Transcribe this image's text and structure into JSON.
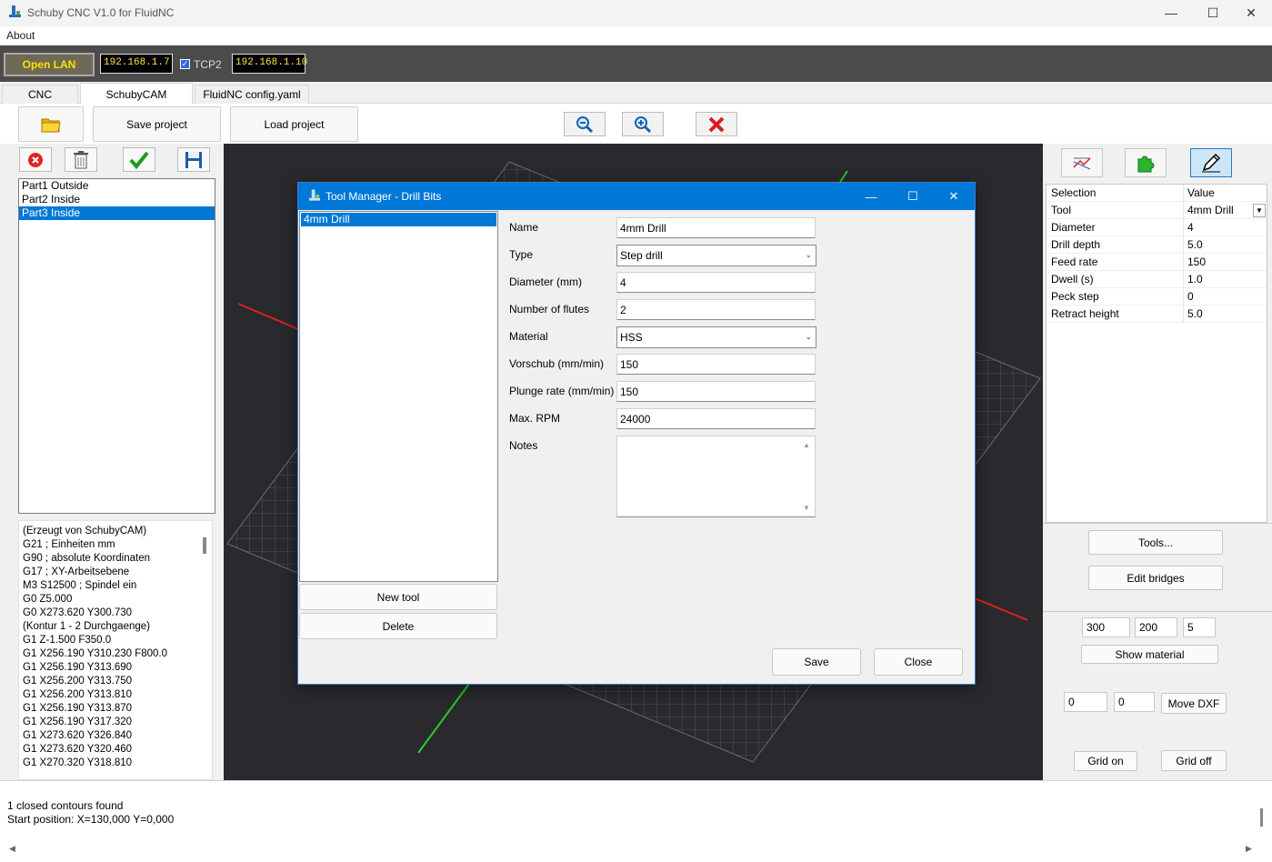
{
  "window": {
    "title": "Schuby CNC  V1.0 for FluidNC",
    "menu": [
      "About"
    ]
  },
  "network": {
    "open_lan_label": "Open LAN",
    "ip1": "192.168.1.7",
    "tcp2_label": "TCP2",
    "tcp2_checked": true,
    "ip2": "192.168.1.10"
  },
  "tabs": [
    {
      "label": "CNC"
    },
    {
      "label": "SchubyCAM",
      "active": true
    },
    {
      "label": "FluidNC config.yaml"
    }
  ],
  "toolbar": {
    "open_icon": "folder-icon",
    "save_project_label": "Save project",
    "load_project_label": "Load project",
    "zoom_out_icon": "zoom-out-icon",
    "zoom_in_icon": "zoom-in-icon",
    "clear_icon": "red-x-icon"
  },
  "left": {
    "parts": [
      {
        "label": "Part1 Outside"
      },
      {
        "label": "Part2 Inside"
      },
      {
        "label": "Part3 Inside",
        "selected": true
      }
    ],
    "gcode_lines": [
      "(Erzeugt von SchubyCAM)",
      "G21 ; Einheiten mm",
      "G90 ; absolute Koordinaten",
      "G17 ; XY-Arbeitsebene",
      "M3 S12500 ; Spindel ein",
      "G0 Z5.000",
      "G0 X273.620 Y300.730",
      "(Kontur 1 - 2 Durchgaenge)",
      "G1 Z-1.500 F350.0",
      "G1 X256.190 Y310.230 F800.0",
      "G1 X256.190 Y313.690",
      "G1 X256.200 Y313.750",
      "G1 X256.200 Y313.810",
      "G1 X256.190 Y313.870",
      "G1 X256.190 Y317.320",
      "G1 X273.620 Y326.840",
      "G1 X273.620 Y320.460",
      "G1 X270.320 Y318.810"
    ]
  },
  "properties": {
    "header_key": "Selection",
    "header_value": "Value",
    "rows": [
      {
        "key": "Tool",
        "value": "4mm Drill"
      },
      {
        "key": "Diameter",
        "value": "4"
      },
      {
        "key": "Drill depth",
        "value": "5.0"
      },
      {
        "key": "Feed rate",
        "value": "150"
      },
      {
        "key": "Dwell (s)",
        "value": "1.0"
      },
      {
        "key": "Peck step",
        "value": "0"
      },
      {
        "key": "Retract height",
        "value": "5.0"
      }
    ],
    "tools_button": "Tools...",
    "edit_bridges_button": "Edit bridges",
    "material_x": "300",
    "material_y": "200",
    "material_z": "5",
    "show_material_button": "Show material",
    "move_x": "0",
    "move_y": "0",
    "move_dxf_button": "Move DXF",
    "grid_on_button": "Grid on",
    "grid_off_button": "Grid off"
  },
  "status": {
    "line1": "1 closed contours found",
    "line2": "Start position: X=130,000 Y=0,000"
  },
  "dialog": {
    "title": "Tool Manager - Drill Bits",
    "tools": [
      {
        "label": "4mm Drill",
        "selected": true
      }
    ],
    "new_tool_button": "New tool",
    "delete_button": "Delete",
    "fields": {
      "name_label": "Name",
      "name_value": "4mm Drill",
      "type_label": "Type",
      "type_value": "Step drill",
      "diameter_label": "Diameter (mm)",
      "diameter_value": "4",
      "flutes_label": "Number of flutes",
      "flutes_value": "2",
      "material_label": "Material",
      "material_value": "HSS",
      "feed_label": "Vorschub (mm/min)",
      "feed_value": "150",
      "plunge_label": "Plunge rate (mm/min)",
      "plunge_value": "150",
      "rpm_label": "Max. RPM",
      "rpm_value": "24000",
      "notes_label": "Notes",
      "notes_value": ""
    },
    "save_button": "Save",
    "close_button": "Close"
  },
  "colors": {
    "accent": "#0078d7",
    "viewport_bg": "#2a2a2e",
    "ip_text": "#ffe34d",
    "open_lan_text": "#ffe000"
  }
}
